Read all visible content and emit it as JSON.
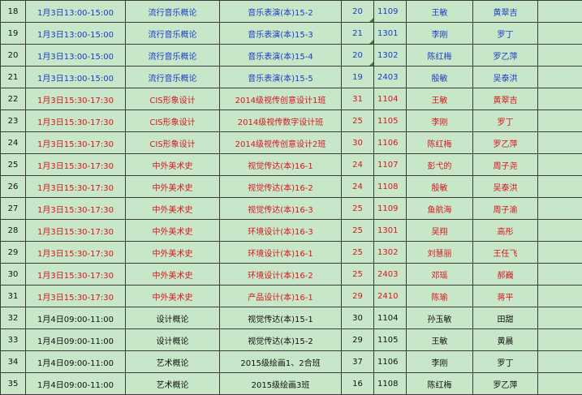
{
  "rows": [
    {
      "idx": "18",
      "time": "1月3日13:00-15:00",
      "course": "流行音乐概论",
      "cls": "音乐表演(本)15-2",
      "count": "20",
      "room": "1109",
      "t1": "王敏",
      "t2": "黄翠吉",
      "color": "blue"
    },
    {
      "idx": "19",
      "time": "1月3日13:00-15:00",
      "course": "流行音乐概论",
      "cls": "音乐表演(本)15-3",
      "count": "21",
      "room": "1301",
      "t1": "李刚",
      "t2": "罗丁",
      "color": "blue"
    },
    {
      "idx": "20",
      "time": "1月3日13:00-15:00",
      "course": "流行音乐概论",
      "cls": "音乐表演(本)15-4",
      "count": "20",
      "room": "1302",
      "t1": "陈红梅",
      "t2": "罗乙萍",
      "color": "blue"
    },
    {
      "idx": "21",
      "time": "1月3日13:00-15:00",
      "course": "流行音乐概论",
      "cls": "音乐表演(本)15-5",
      "count": "19",
      "room": "2403",
      "t1": "殷敏",
      "t2": "吴泰洪",
      "color": "blue"
    },
    {
      "idx": "22",
      "time": "1月3日15:30-17:30",
      "course": "CIS形象设计",
      "cls": "2014级视传创意设计1班",
      "count": "31",
      "room": "1104",
      "t1": "王敏",
      "t2": "黄翠吉",
      "color": "red"
    },
    {
      "idx": "23",
      "time": "1月3日15:30-17:30",
      "course": "CIS形象设计",
      "cls": "2014级视传数字设计班",
      "count": "25",
      "room": "1105",
      "t1": "李刚",
      "t2": "罗丁",
      "color": "red"
    },
    {
      "idx": "24",
      "time": "1月3日15:30-17:30",
      "course": "CIS形象设计",
      "cls": "2014级视传创意设计2班",
      "count": "30",
      "room": "1106",
      "t1": "陈红梅",
      "t2": "罗乙萍",
      "color": "red"
    },
    {
      "idx": "25",
      "time": "1月3日15:30-17:30",
      "course": "中外美术史",
      "cls": "视觉传达(本)16-1",
      "count": "24",
      "room": "1107",
      "t1": "彭弋的",
      "t2": "周子尧",
      "color": "red"
    },
    {
      "idx": "26",
      "time": "1月3日15:30-17:30",
      "course": "中外美术史",
      "cls": "视觉传达(本)16-2",
      "count": "24",
      "room": "1108",
      "t1": "殷敏",
      "t2": "吴泰洪",
      "color": "red"
    },
    {
      "idx": "27",
      "time": "1月3日15:30-17:30",
      "course": "中外美术史",
      "cls": "视觉传达(本)16-3",
      "count": "25",
      "room": "1109",
      "t1": "鱼航海",
      "t2": "周子渝",
      "color": "red"
    },
    {
      "idx": "28",
      "time": "1月3日15:30-17:30",
      "course": "中外美术史",
      "cls": "环境设计(本)16-3",
      "count": "25",
      "room": "1301",
      "t1": "吴翔",
      "t2": "高彤",
      "color": "red"
    },
    {
      "idx": "29",
      "time": "1月3日15:30-17:30",
      "course": "中外美术史",
      "cls": "环境设计(本)16-1",
      "count": "25",
      "room": "1302",
      "t1": "刘慧丽",
      "t2": "王任飞",
      "color": "red"
    },
    {
      "idx": "30",
      "time": "1月3日15:30-17:30",
      "course": "中外美术史",
      "cls": "环境设计(本)16-2",
      "count": "25",
      "room": "2403",
      "t1": "邓瑶",
      "t2": "郝巍",
      "color": "red"
    },
    {
      "idx": "31",
      "time": "1月3日15:30-17:30",
      "course": "中外美术史",
      "cls": "产品设计(本)16-1",
      "count": "29",
      "room": "2410",
      "t1": "陈瑜",
      "t2": "蒋平",
      "color": "red"
    },
    {
      "idx": "32",
      "time": "1月4日09:00-11:00",
      "course": "设计概论",
      "cls": "视觉传达(本)15-1",
      "count": "30",
      "room": "1104",
      "t1": "孙玉敏",
      "t2": "田甜",
      "color": "black"
    },
    {
      "idx": "33",
      "time": "1月4日09:00-11:00",
      "course": "设计概论",
      "cls": "视觉传达(本)15-2",
      "count": "29",
      "room": "1105",
      "t1": "王敏",
      "t2": "黄晨",
      "color": "black"
    },
    {
      "idx": "34",
      "time": "1月4日09:00-11:00",
      "course": "艺术概论",
      "cls": "2015级绘画1、2合班",
      "count": "37",
      "room": "1106",
      "t1": "李刚",
      "t2": "罗丁",
      "color": "black"
    },
    {
      "idx": "35",
      "time": "1月4日09:00-11:00",
      "course": "艺术概论",
      "cls": "2015级绘画3班",
      "count": "16",
      "room": "1108",
      "t1": "陈红梅",
      "t2": "罗乙萍",
      "color": "black"
    }
  ],
  "colors": {
    "background": "#c8e6c8",
    "blue": "#1a3cc8",
    "red": "#d8141e",
    "black": "#111111",
    "grid": "#3c3c3c"
  },
  "markers": {
    "room_triangle_rows": [
      0,
      1,
      2
    ]
  }
}
